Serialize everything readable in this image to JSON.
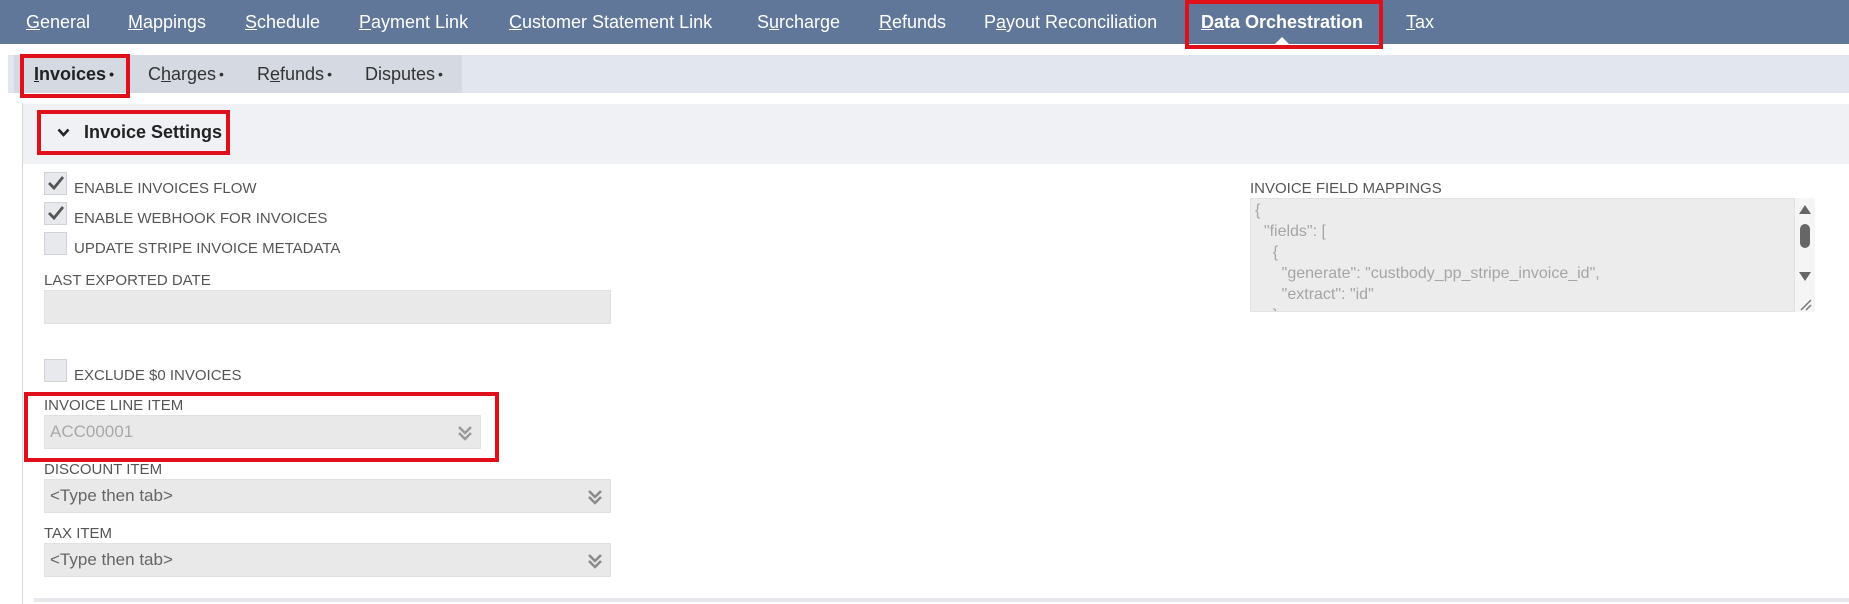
{
  "top_tabs": [
    {
      "pre": "",
      "u": "G",
      "post": "eneral"
    },
    {
      "pre": "",
      "u": "M",
      "post": "appings"
    },
    {
      "pre": "",
      "u": "S",
      "post": "chedule"
    },
    {
      "pre": "",
      "u": "P",
      "post": "ayment Link"
    },
    {
      "pre": "",
      "u": "C",
      "post": "ustomer Statement Link"
    },
    {
      "pre": "S",
      "u": "u",
      "post": "rcharge"
    },
    {
      "pre": "",
      "u": "R",
      "post": "efunds"
    },
    {
      "pre": "P",
      "u": "a",
      "post": "yout Reconciliation"
    },
    {
      "pre": "",
      "u": "D",
      "post": "ata Orchestration"
    },
    {
      "pre": "",
      "u": "T",
      "post": "ax"
    }
  ],
  "sub_tabs": [
    {
      "pre": "",
      "u": "I",
      "post": "nvoices",
      "dot": "•"
    },
    {
      "pre": "C",
      "u": "h",
      "post": "arges",
      "dot": "•"
    },
    {
      "pre": "R",
      "u": "e",
      "post": "funds",
      "dot": "•"
    },
    {
      "pre": "",
      "u": "",
      "post": "Disputes",
      "dot": "•"
    }
  ],
  "section": {
    "title": "Invoice Settings"
  },
  "checkboxes": {
    "enable_invoices_flow": {
      "label": "ENABLE INVOICES FLOW",
      "checked": true
    },
    "enable_webhook": {
      "label": "ENABLE WEBHOOK FOR INVOICES",
      "checked": true
    },
    "update_metadata": {
      "label": "UPDATE STRIPE INVOICE METADATA",
      "checked": false
    },
    "exclude_zero": {
      "label": "EXCLUDE $0 INVOICES",
      "checked": false
    }
  },
  "fields": {
    "last_exported_date": {
      "label": "LAST EXPORTED DATE",
      "value": ""
    },
    "invoice_line_item": {
      "label": "INVOICE LINE ITEM",
      "value": "ACC00001"
    },
    "discount_item": {
      "label": "DISCOUNT ITEM",
      "value": "<Type then tab>"
    },
    "tax_item": {
      "label": "TAX ITEM",
      "value": "<Type then tab>"
    }
  },
  "mappings": {
    "label": "INVOICE FIELD MAPPINGS",
    "lines": [
      "{",
      "  \"fields\": [",
      "    {",
      "      \"generate\": \"custbody_pp_stripe_invoice_id\",",
      "      \"extract\": \"id\"",
      "    },"
    ]
  },
  "colors": {
    "topbar": "#607799",
    "highlight": "#e0101a"
  }
}
